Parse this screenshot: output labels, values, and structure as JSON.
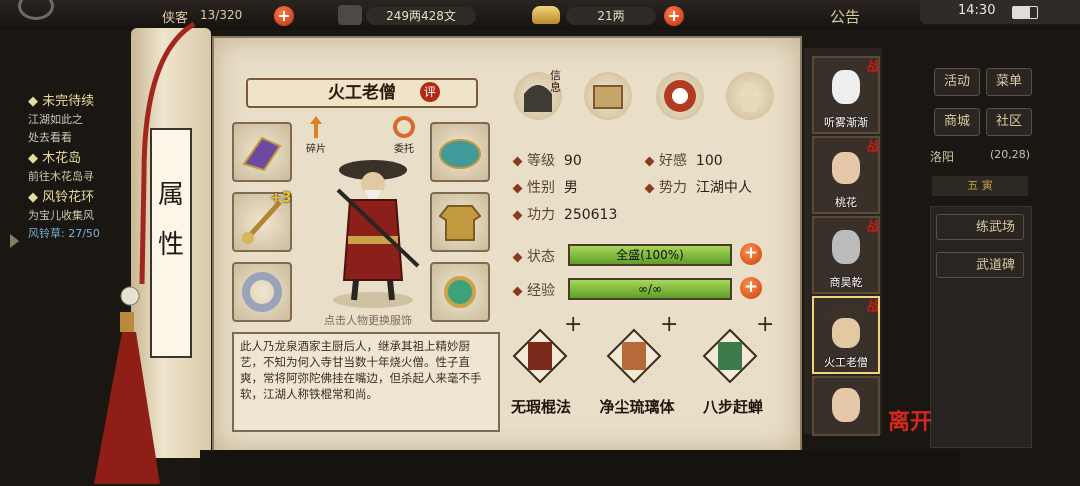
{
  "topbar": {
    "roster_count": "13/320",
    "copper": "249两428文",
    "gold": "21两",
    "notice": "公告",
    "clock": "14:30"
  },
  "quest": {
    "items": [
      {
        "header": "◆ 未完待续",
        "detail": "江湖如此之"
      },
      {
        "header": "",
        "detail": "处去看看"
      },
      {
        "header": "◆ 木花岛",
        "detail": "前往木花岛寻"
      },
      {
        "header": "◆ 风铃花环",
        "detail": "为宝儿收集风"
      },
      {
        "header": "",
        "detail": "风铃草: 27/50"
      }
    ]
  },
  "sidenav": {
    "activity": "活动",
    "menu": "菜单",
    "shop": "商城",
    "community": "社区",
    "location": "洛阳",
    "coords": "(20,28)",
    "time": "五 寅",
    "training_ground": "练武场",
    "martial_stele": "武道碑"
  },
  "scroll": {
    "tab_label_line1": "属",
    "tab_label_line2": "性"
  },
  "character": {
    "name": "火工老僧",
    "review_badge": "评",
    "shard_label": "碎片",
    "entrust_label": "委托",
    "plus_badge": "+3",
    "hint": "点击人物更换服饰",
    "description": "此人乃龙泉酒家主厨后人，继承其祖上精妙厨艺，不知为何入寺甘当数十年烧火僧。性子直爽，常将阿弥陀佛挂在嘴边，但杀起人来毫不手软，江湖人称铁棍常和尚。",
    "icons": [
      {
        "name": "letter-icon",
        "label": "信息"
      },
      {
        "name": "map-icon",
        "label": ""
      },
      {
        "name": "taiji-icon",
        "label": ""
      },
      {
        "name": "muscle-icon",
        "label": ""
      }
    ]
  },
  "stats": {
    "level_label": "等级",
    "level": "90",
    "favor_label": "好感",
    "favor": "100",
    "gender_label": "性别",
    "gender": "男",
    "faction_label": "势力",
    "faction": "江湖中人",
    "power_label": "功力",
    "power": "250613",
    "status_label": "状态",
    "status_text": "全盛(100%)",
    "status_fill": 1.0,
    "exp_label": "经验",
    "exp_text": "∞/∞",
    "exp_fill": 1.0
  },
  "skills": [
    {
      "name": "无瑕棍法"
    },
    {
      "name": "净尘琉璃体"
    },
    {
      "name": "八步赶蝉"
    }
  ],
  "portraits": [
    {
      "name": "听雾渐渐",
      "war": "战"
    },
    {
      "name": "桃花",
      "war": "战"
    },
    {
      "name": "商昊乾",
      "war": "战"
    },
    {
      "name": "火工老僧",
      "war": "战"
    },
    {
      "name": "",
      "war": ""
    }
  ],
  "leave_label": "离开",
  "colors": {
    "parchment": "#e9dfc8",
    "accent_red": "#c81e12",
    "bar_green": "#7fbf3a"
  }
}
